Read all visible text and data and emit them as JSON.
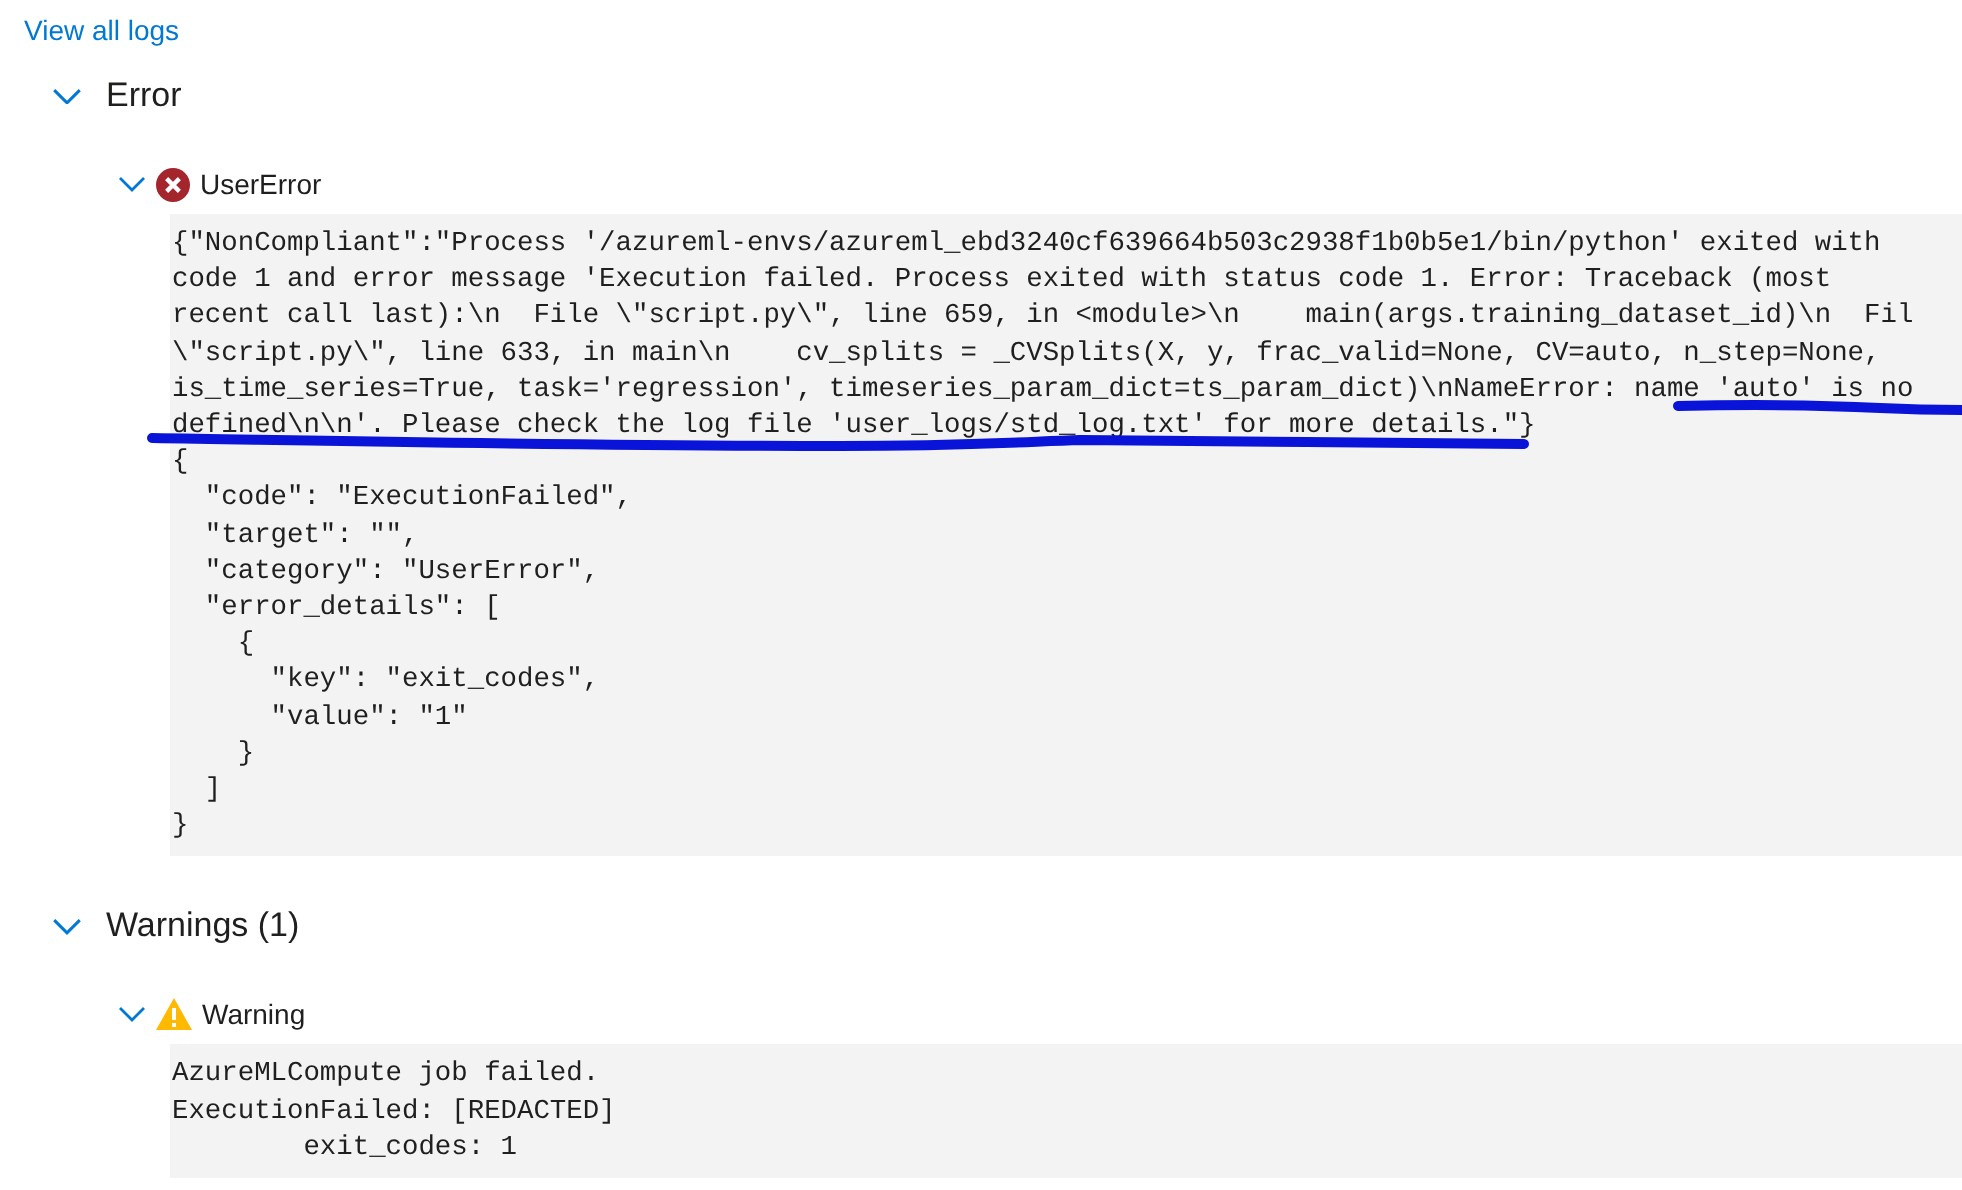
{
  "link": "View all logs",
  "sections": [
    {
      "title": "Error",
      "expanded": true,
      "items": [
        {
          "kind": "error",
          "title": "UserError",
          "expanded": true,
          "lines": [
            "{\"NonCompliant\":\"Process '/azureml-envs/azureml_ebd3240cf639664b503c2938f1b0b5e1/bin/python' exited with",
            "code 1 and error message 'Execution failed. Process exited with status code 1. Error: Traceback (most",
            "recent call last):\\n  File \\\"script.py\\\", line 659, in <module>\\n    main(args.training_dataset_id)\\n  Fil",
            "\\\"script.py\\\", line 633, in main\\n    cv_splits = _CVSplits(X, y, frac_valid=None, CV=auto, n_step=None,",
            "is_time_series=True, task='regression', timeseries_param_dict=ts_param_dict)\\nNameError: name 'auto' is no",
            "defined\\n\\n'. Please check the log file 'user_logs/std_log.txt' for more details.\"}",
            "{",
            "  \"code\": \"ExecutionFailed\",",
            "  \"target\": \"\",",
            "  \"category\": \"UserError\",",
            "  \"error_details\": [",
            "    {",
            "      \"key\": \"exit_codes\",",
            "      \"value\": \"1\"",
            "    }",
            "  ]",
            "}"
          ]
        }
      ]
    },
    {
      "title": "Warnings (1)",
      "expanded": true,
      "items": [
        {
          "kind": "warning",
          "title": "Warning",
          "expanded": true,
          "lines": [
            "AzureMLCompute job failed.",
            "ExecutionFailed: [REDACTED]",
            "        exit_codes: 1"
          ]
        }
      ]
    }
  ]
}
